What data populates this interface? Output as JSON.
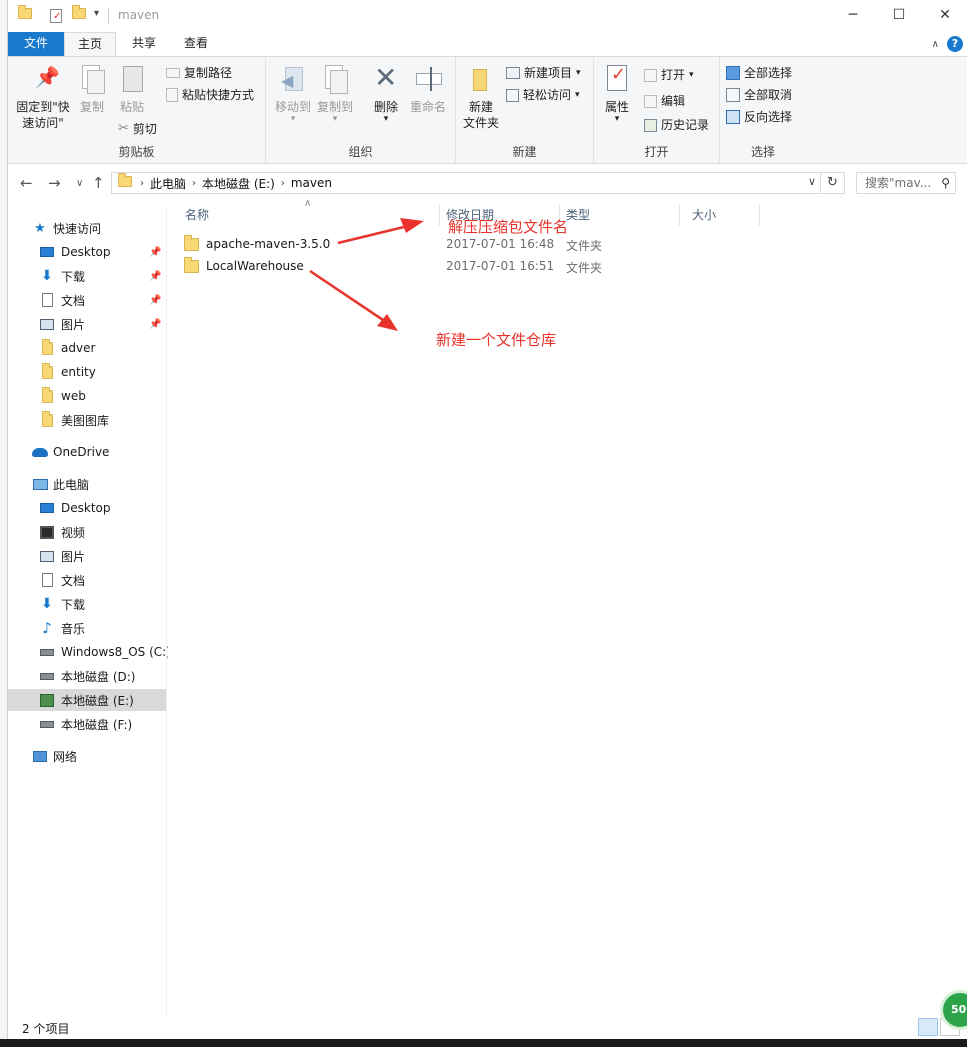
{
  "window": {
    "title": "maven"
  },
  "tabs": {
    "file": "文件",
    "home": "主页",
    "share": "共享",
    "view": "查看"
  },
  "ribbon": {
    "clipboard": {
      "label": "剪贴板",
      "pin_quick_line1": "固定到\"快",
      "pin_quick_line2": "速访问\"",
      "copy": "复制",
      "paste": "粘贴",
      "copy_path": "复制路径",
      "paste_shortcut": "粘贴快捷方式",
      "cut": "剪切"
    },
    "organize": {
      "label": "组织",
      "move_to": "移动到",
      "copy_to": "复制到",
      "delete": "删除",
      "rename": "重命名"
    },
    "new": {
      "label": "新建",
      "new_folder_line1": "新建",
      "new_folder_line2": "文件夹",
      "new_item": "新建项目",
      "easy_access": "轻松访问"
    },
    "open": {
      "label": "打开",
      "properties": "属性",
      "open": "打开",
      "edit": "编辑",
      "history": "历史记录"
    },
    "select": {
      "label": "选择",
      "select_all": "全部选择",
      "select_none": "全部取消",
      "invert": "反向选择"
    }
  },
  "address": {
    "crumbs": [
      "此电脑",
      "本地磁盘 (E:)",
      "maven"
    ],
    "search_placeholder": "搜索\"mav..."
  },
  "nav": {
    "quick_access": "快速访问",
    "quick_items": [
      "Desktop",
      "下载",
      "文档",
      "图片",
      "adver",
      "entity",
      "web",
      "美图图库"
    ],
    "onedrive": "OneDrive",
    "this_pc": "此电脑",
    "pc_items": [
      "Desktop",
      "视频",
      "图片",
      "文档",
      "下载",
      "音乐",
      "Windows8_OS (C:)",
      "本地磁盘 (D:)",
      "本地磁盘 (E:)",
      "本地磁盘 (F:)"
    ],
    "network": "网络"
  },
  "columns": {
    "name": "名称",
    "modified": "修改日期",
    "type": "类型",
    "size": "大小"
  },
  "files": [
    {
      "name": "apache-maven-3.5.0",
      "modified": "2017-07-01 16:48",
      "type": "文件夹"
    },
    {
      "name": "LocalWarehouse",
      "modified": "2017-07-01 16:51",
      "type": "文件夹"
    }
  ],
  "annotations": {
    "unzip": "解压压缩包文件名",
    "new_repo": "新建一个文件仓库"
  },
  "status": {
    "count": "2 个项目",
    "badge": "50"
  },
  "colors": {
    "accent": "#1979ca",
    "annotation": "#e8332c",
    "folder": "#f8d775",
    "selected_nav": "#d9d9d9"
  }
}
